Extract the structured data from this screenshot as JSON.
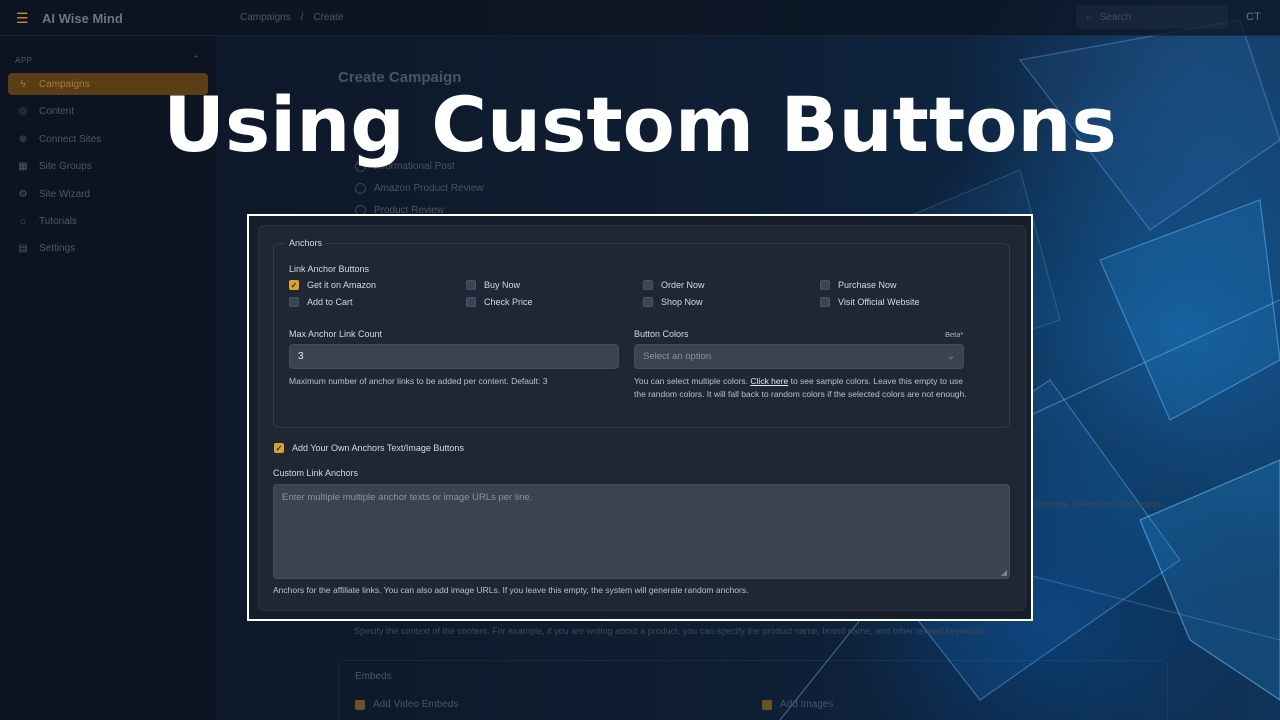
{
  "app": {
    "name": "AI Wise Mind",
    "user_initials": "CT"
  },
  "breadcrumb": [
    "Campaigns",
    "/",
    "Create"
  ],
  "search": {
    "placeholder": "Search"
  },
  "sidebar": {
    "section": "APP",
    "items": [
      {
        "label": "Campaigns",
        "icon": "bolt-icon",
        "active": true
      },
      {
        "label": "Content",
        "icon": "database-icon",
        "active": false
      },
      {
        "label": "Connect Sites",
        "icon": "globe-icon",
        "active": false
      },
      {
        "label": "Site Groups",
        "icon": "grid-icon",
        "active": false
      },
      {
        "label": "Site Wizard",
        "icon": "gear-icon",
        "active": false
      },
      {
        "label": "Tutorials",
        "icon": "lightbulb-icon",
        "active": false
      },
      {
        "label": "Settings",
        "icon": "document-icon",
        "active": false
      }
    ]
  },
  "page": {
    "title": "Create Campaign",
    "content_types": [
      "Informational Post",
      "Amazon Product Review",
      "Product Review"
    ],
    "faded_help_right": "Optional. Maximum 1000 words",
    "context_help": "Specify the context of the content. For example, if you are writing about a product, you can specify the product name, brand name, and other related keywords.",
    "embeds": {
      "legend": "Embeds",
      "video_label": "Add Video Embeds",
      "images_label": "Add Images"
    }
  },
  "overlay_title": "Using Custom Buttons",
  "anchors": {
    "legend": "Anchors",
    "link_buttons_label": "Link Anchor Buttons",
    "buttons": [
      {
        "label": "Get it on Amazon",
        "checked": true
      },
      {
        "label": "Buy Now",
        "checked": false
      },
      {
        "label": "Order Now",
        "checked": false
      },
      {
        "label": "Purchase Now",
        "checked": false
      },
      {
        "label": "Add to Cart",
        "checked": false
      },
      {
        "label": "Check Price",
        "checked": false
      },
      {
        "label": "Shop Now",
        "checked": false
      },
      {
        "label": "Visit Official Website",
        "checked": false
      }
    ],
    "max_count_label": "Max Anchor Link Count",
    "max_count_value": "3",
    "max_count_help": "Maximum number of anchor links to be added per content. Default: 3",
    "colors_label": "Button Colors",
    "colors_badge": "Beta*",
    "colors_placeholder": "Select an option",
    "colors_help_before": "You can select multiple colors.",
    "colors_help_link": "Click here",
    "colors_help_after": "to see sample colors. Leave this empty to use the random colors. It will fall back to random colors if the selected colors are not enough.",
    "own_anchors_label": "Add Your Own Anchors Text/Image Buttons",
    "own_anchors_checked": true,
    "custom_label": "Custom Link Anchors",
    "custom_placeholder": "Enter multiple multiple anchor texts or image URLs per line.",
    "custom_help": "Anchors for the affiliate links. You can also add image URLs. If you leave this empty, the system will generate random anchors."
  },
  "colors": {
    "accent": "#e0a030",
    "panel_bg": "#1f2735"
  }
}
